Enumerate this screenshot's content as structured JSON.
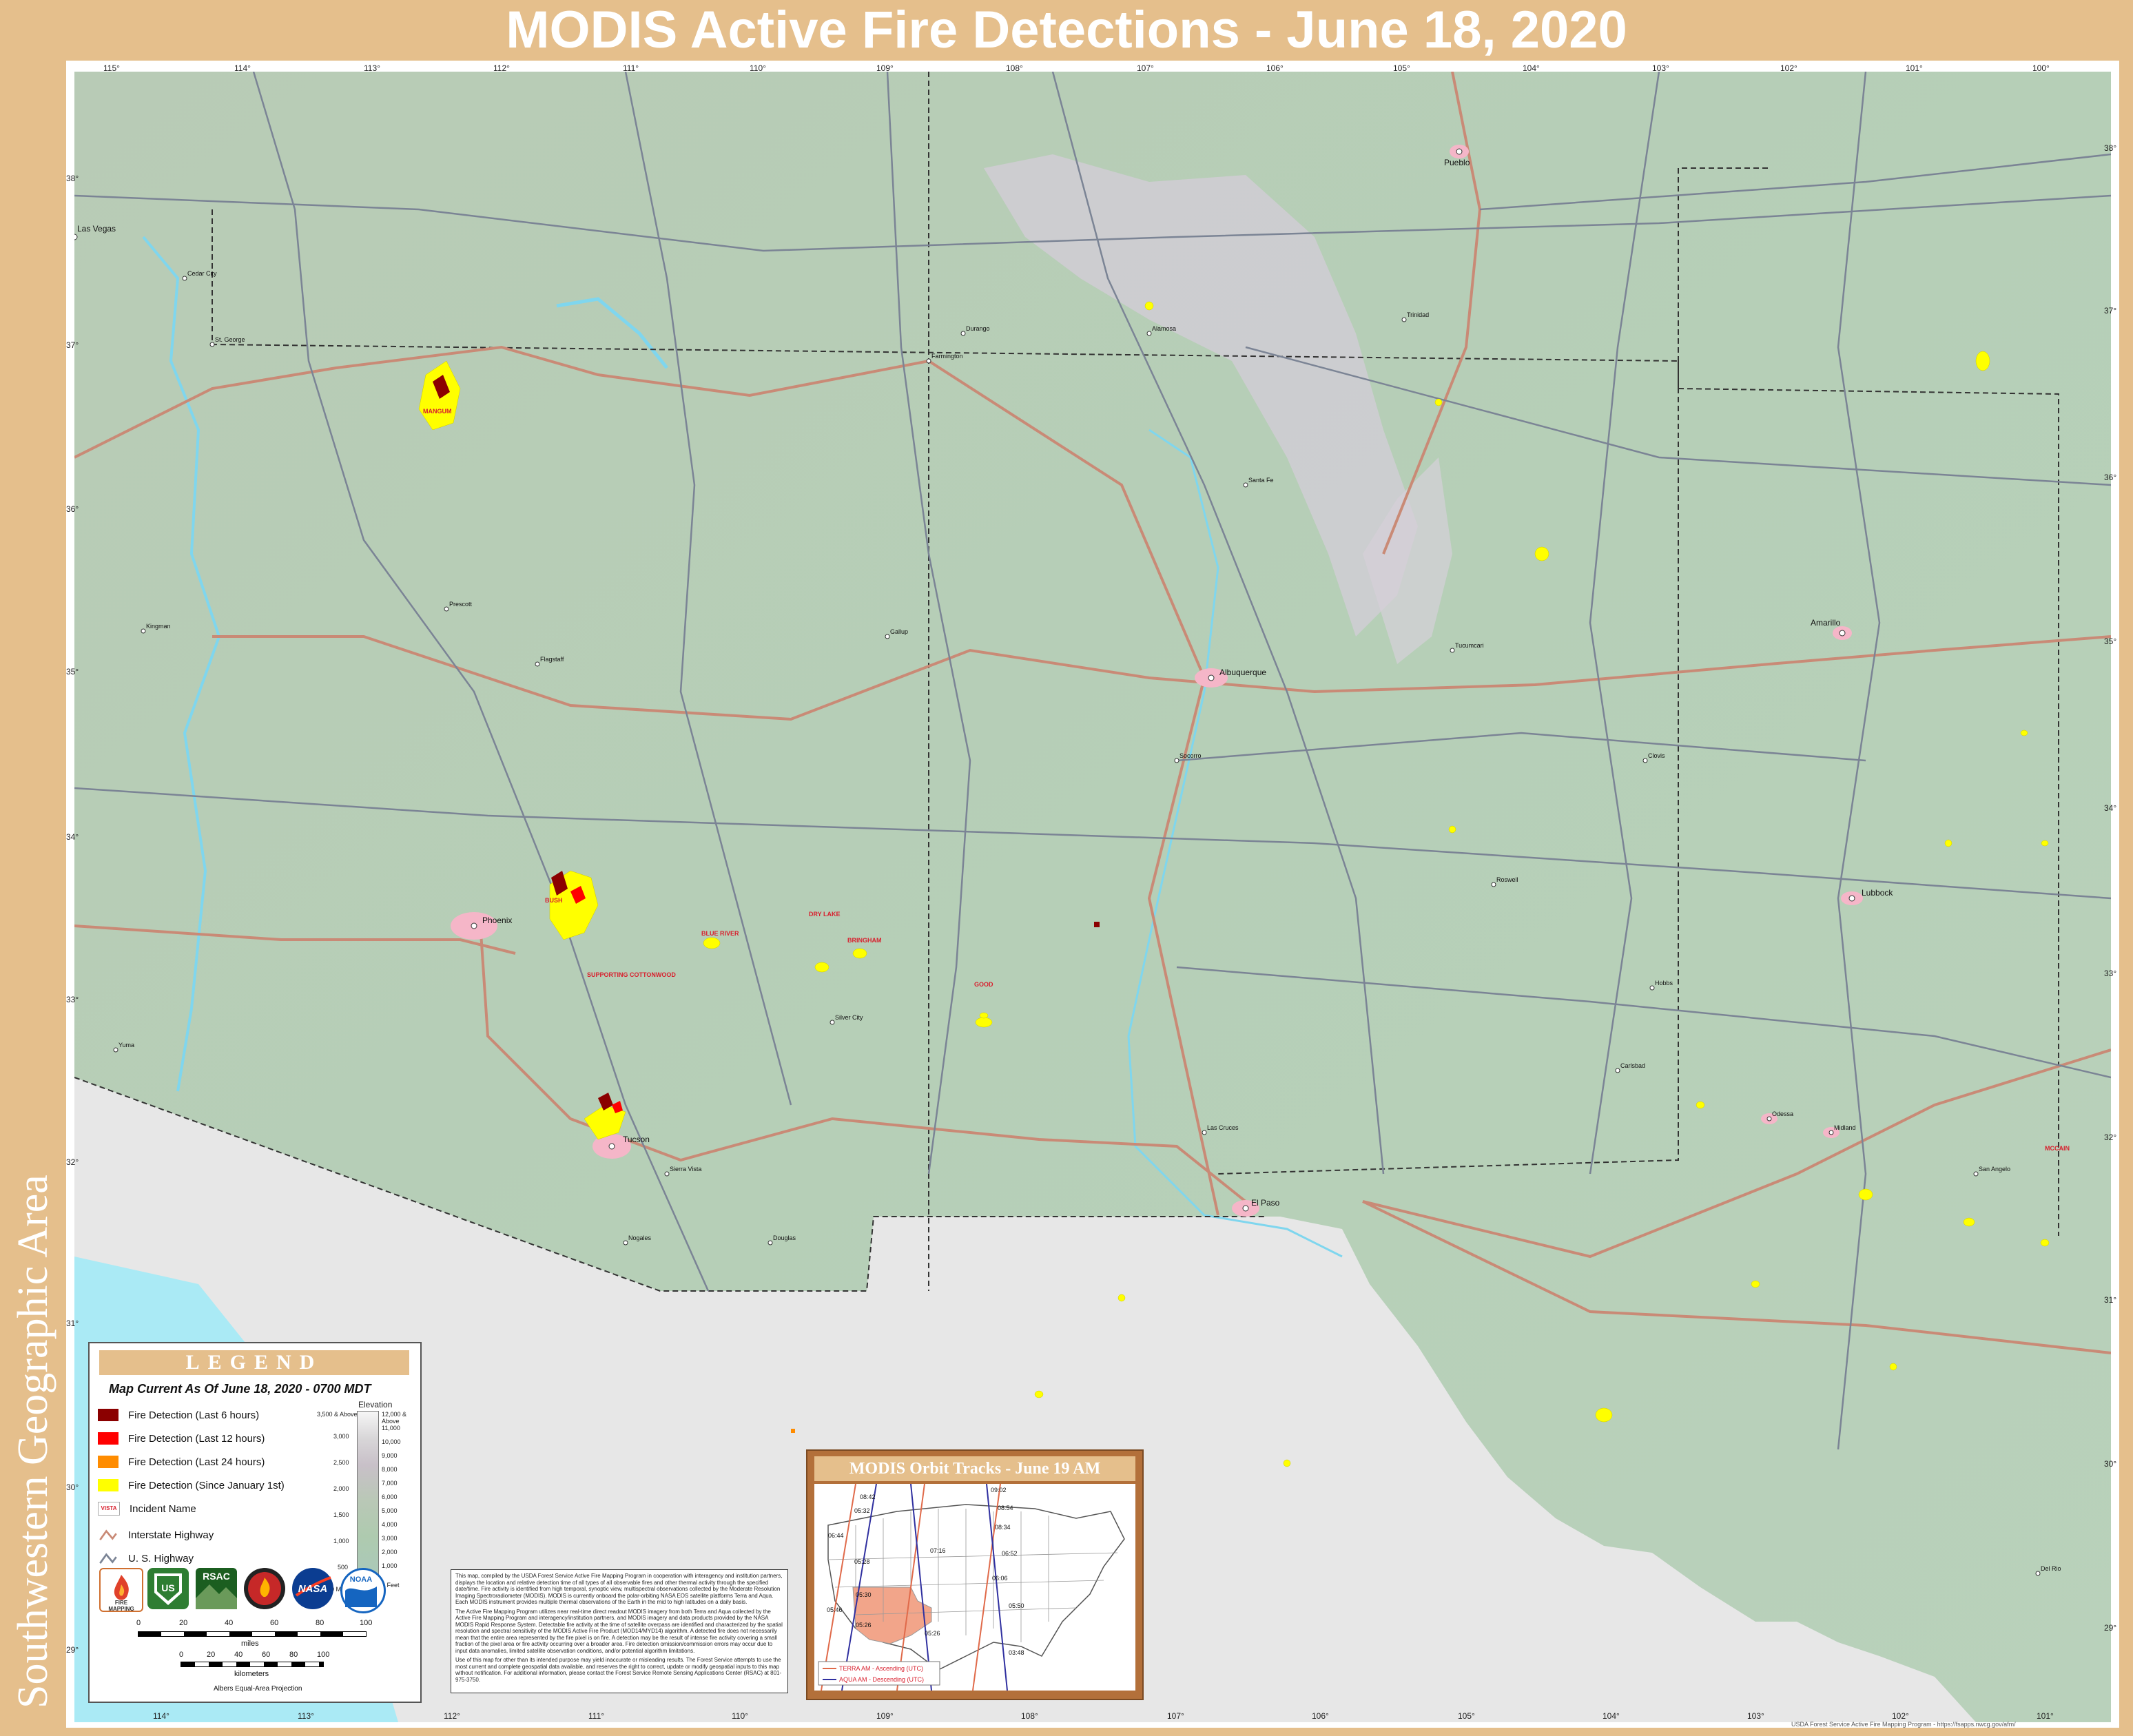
{
  "title": "MODIS Active Fire Detections - June 18, 2020",
  "side_title": "Southwestern Geographic Area",
  "colors": {
    "border": "#e5bf8c",
    "terrain": "#b7ceb6",
    "mexico": "#e7e7e7",
    "water": "#aaeaf5",
    "interstate": "#c98a76",
    "us_highway": "#7b8495",
    "fire_6h": "#8b0000",
    "fire_12h": "#ff0000",
    "fire_24h": "#ff8c00",
    "fire_since_jan": "#ffff00",
    "incident_label": "#d8202e"
  },
  "graticule": {
    "top": [
      "115°",
      "114°",
      "113°",
      "112°",
      "111°",
      "110°",
      "109°",
      "108°",
      "107°",
      "106°",
      "105°",
      "104°",
      "103°",
      "102°",
      "101°",
      "100°"
    ],
    "bottom": [
      "114°",
      "113°",
      "112°",
      "111°",
      "110°",
      "109°",
      "108°",
      "107°",
      "106°",
      "105°",
      "104°",
      "103°",
      "102°",
      "101°"
    ],
    "left": [
      "38°",
      "37°",
      "36°",
      "35°",
      "34°",
      "33°",
      "32°",
      "31°",
      "30°",
      "29°"
    ],
    "right": [
      "38°",
      "37°",
      "36°",
      "35°",
      "34°",
      "33°",
      "32°",
      "31°",
      "30°",
      "29°"
    ]
  },
  "cities": {
    "phoenix": "Phoenix",
    "tucson": "Tucson",
    "albuquerque": "Albuquerque",
    "el_paso": "El Paso",
    "lubbock": "Lubbock",
    "amarillo": "Amarillo",
    "pueblo": "Pueblo",
    "las_vegas": "Las Vegas",
    "kingman": "Kingman",
    "flagstaff": "Flagstaff",
    "las_cruces": "Las Cruces",
    "odessa": "Odessa",
    "midland": "Midland",
    "roswell": "Roswell",
    "santa_fe": "Santa Fe",
    "farmington": "Farmington",
    "gallup": "Gallup",
    "yuma": "Yuma",
    "prescott": "Prescott",
    "durango": "Durango",
    "alamosa": "Alamosa",
    "trinidad": "Trinidad",
    "clovis": "Clovis",
    "hobbs": "Hobbs",
    "carlsbad": "Carlsbad",
    "san_angelo": "San Angelo",
    "del_rio": "Del Rio",
    "st_george": "St. George",
    "cedar_city": "Cedar City",
    "tucumcari": "Tucumcari",
    "socorro": "Socorro",
    "silver_city": "Silver City",
    "douglas": "Douglas",
    "nogales": "Nogales",
    "sierra_vista": "Sierra Vista"
  },
  "incidents": {
    "mangum": "MANGUM",
    "bush": "BUSH",
    "blue_river": "BLUE RIVER",
    "dry_lake": "DRY LAKE",
    "bringham": "BRINGHAM",
    "supporting_cottonwood": "SUPPORTING COTTONWOOD",
    "good": "GOOD",
    "mccain": "MCCAIN"
  },
  "legend": {
    "title": "LEGEND",
    "subtitle": "Map Current As Of June 18, 2020 - 0700 MDT",
    "items": [
      {
        "label": "Fire Detection (Last 6 hours)",
        "color": "#8b0000"
      },
      {
        "label": "Fire Detection (Last 12 hours)",
        "color": "#ff0000"
      },
      {
        "label": "Fire Detection (Last 24 hours)",
        "color": "#ff8c00"
      },
      {
        "label": "Fire Detection (Since January 1st)",
        "color": "#ffff00"
      }
    ],
    "incident_name_label": "Incident Name",
    "incident_example": "VISTA",
    "interstate_label": "Interstate Highway",
    "us_highway_label": "U. S. Highway",
    "elevation_title": "Elevation",
    "elevation_meters": [
      "3,500 & Above",
      "3,000",
      "2,500",
      "2,000",
      "1,500",
      "1,000",
      "500",
      "0 Meters"
    ],
    "elevation_feet": [
      "12,000 & Above",
      "11,000",
      "10,000",
      "9,000",
      "8,000",
      "7,000",
      "6,000",
      "5,000",
      "4,000",
      "3,000",
      "2,000",
      "1,000",
      "0 Feet"
    ],
    "logo_text": {
      "fire_mapping": "FIRE MAPPING",
      "rsac": "RSAC",
      "nasa": "NASA",
      "noaa": "NOAA"
    },
    "scale_miles": [
      "0",
      "20",
      "40",
      "60",
      "80",
      "100"
    ],
    "scale_miles_label": "miles",
    "scale_km": [
      "0",
      "20",
      "40",
      "60",
      "80",
      "100"
    ],
    "scale_km_label": "kilometers",
    "projection": "Albers Equal-Area Projection"
  },
  "disclaimer": [
    "This map, compiled by the USDA Forest Service Active Fire Mapping Program in cooperation with interagency and institution partners, displays the location and relative detection time of all types of all observable fires and other thermal activity through the specified date/time. Fire activity is identified from high temporal, synoptic view, multispectral observations collected by the Moderate Resolution Imaging Spectroradiometer (MODIS). MODIS is currently onboard the polar-orbiting NASA EOS satellite platforms Terra and Aqua. Each MODIS instrument provides multiple thermal observations of the Earth in the mid to high latitudes on a daily basis.",
    "The Active Fire Mapping Program utilizes near real-time direct readout MODIS imagery from both Terra and Aqua collected by the Active Fire Mapping Program and interagency/institution partners, and MODIS imagery and data products provided by the NASA MODIS Rapid Response System. Detectable fire activity at the time of satellite overpass are identified and characterized by the spatial resolution and spectral sensitivity of the MODIS Active Fire Product (MOD14/MYD14) algorithm. A detected fire does not necessarily mean that the entire area represented by the fire pixel is on fire. A detection may be the result of intense fire activity covering a small fraction of the pixel area or fire activity occurring over a broader area. Fire detection omission/commission errors may occur due to input data anomalies, limited satellite observation conditions, and/or potential algorithm limitations.",
    "Use of this map for other than its intended purpose may yield inaccurate or misleading results. The Forest Service attempts to use the most current and complete geospatial data available, and reserves the right to correct, update or modify geospatial inputs to this map without notification. For additional information, please contact the Forest Service Remote Sensing Applications Center (RSAC) at 801-975-3750."
  ],
  "inset": {
    "title": "MODIS Orbit Tracks - June 19 AM",
    "times": [
      "09:02",
      "08:42",
      "08:54",
      "05:32",
      "06:44",
      "08:34",
      "07:16",
      "05:28",
      "06:52",
      "05:30",
      "06:06",
      "05:46",
      "05:50",
      "05:26",
      "05:26",
      "03:48"
    ],
    "legend_terra": "TERRA AM - Ascending (UTC)",
    "legend_aqua": "AQUA AM - Descending (UTC)"
  },
  "credit": "USDA Forest Service Active Fire Mapping Program - https://fsapps.nwcg.gov/afm/"
}
